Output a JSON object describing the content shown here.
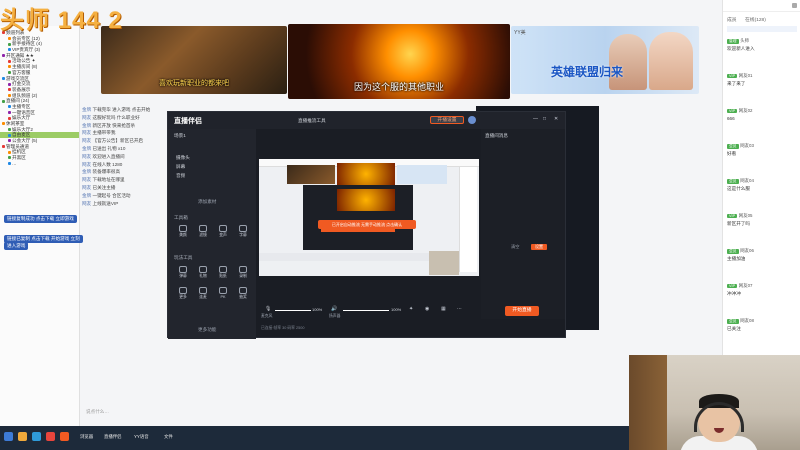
{
  "overlay": {
    "title": "头师 144 2"
  },
  "colors": {
    "accent_orange": "#f05a22",
    "select_green": "#9ccc65",
    "bubble_blue": "#2f5db5",
    "badge_green": "#4caf50"
  },
  "banners": [
    {
      "caption": "喜欢玩新职业的都来吧"
    },
    {
      "caption": "因为这个服的其他职业",
      "chip": ""
    },
    {
      "caption": "英雄联盟归来",
      "chip": "YY美"
    }
  ],
  "tree": [
    "频道列表",
    "会员专区 (12)",
    "新手接待区 (4)",
    "VIP贵宾厅 (3)",
    "开区通知 ★★",
    "活动公告 ✦",
    "主播房间 (8)",
    "官方客服",
    "游戏交流区",
    "打金交流",
    "装备展示",
    "组队频道 (2)",
    "直播间 (24)",
    "主播专区",
    "一键语音区",
    "娱乐大厅",
    "休闲茶室",
    "娱乐大厅2",
    "自由麦区",
    "公会大厅 (5)",
    "管理员通道",
    "挂机区",
    "开黑区",
    "…"
  ],
  "chat": {
    "rows": [
      {
        "user": "金牌",
        "text": "下载完毕 进入游戏 点击开始"
      },
      {
        "user": "网友",
        "text": "这服好玩吗 什么职业好"
      },
      {
        "user": "金牌",
        "text": "新区开放 快来抢首杀"
      },
      {
        "user": "网友",
        "text": "主播带带我"
      },
      {
        "user": "网友",
        "text": "【官方公告】新区已开启"
      },
      {
        "user": "金牌",
        "text": "已送出 礼物 x10"
      },
      {
        "user": "网友",
        "text": "欢迎进入直播间"
      },
      {
        "user": "网友",
        "text": "在线人数 1280"
      },
      {
        "user": "金牌",
        "text": "装备爆率很高"
      },
      {
        "user": "网友",
        "text": "下载地址在哪里"
      },
      {
        "user": "网友",
        "text": "已关注主播"
      },
      {
        "user": "金牌",
        "text": "一键起号 合区活动"
      },
      {
        "user": "网友",
        "text": "上线就送VIP"
      }
    ],
    "bubble1": "链接复制成功 点击下载 立即游戏",
    "bubble2": "链接已复制 点击下载 开始游戏 立刻",
    "bubble3": "进入游戏",
    "input_placeholder": "说点什么…"
  },
  "stream_window": {
    "app_name": "直播伴侣",
    "title": "直播推流工具",
    "scene_label": "场景1",
    "side_items": [
      "场景1",
      "摄像头",
      "屏幕",
      "音频"
    ],
    "add_label": "添加素材",
    "section_tools": "工具箱",
    "section_features": "玩法工具",
    "tools": [
      "美颜",
      "滤镜",
      "变声",
      "字幕",
      "弹幕",
      "礼物",
      "贴纸",
      "录制",
      "更多",
      "连麦",
      "PK",
      "抽奖"
    ],
    "more_link": "更多功能",
    "go_live": "开始直播",
    "volume1": "100%",
    "volume2": "100%",
    "mic_label": "麦克风",
    "speaker_label": "扬声器",
    "top_btn": "开播设置",
    "right_title": "直播间消息",
    "right_btn1": "清空",
    "right_btn2": "设置",
    "popup_text": "已开启自动推流 无需手动推流 点击确认",
    "popup_btn": "确认",
    "status": "已连接 帧率 30 码率 2500"
  },
  "right_panel": {
    "tab1": "成员",
    "tab2": "在线(128)",
    "users": [
      {
        "name": "头师",
        "badge": "管理",
        "msg": "欢迎新人进入"
      },
      {
        "name": "网友01",
        "badge": "VIP",
        "msg": "来了来了"
      },
      {
        "name": "网友02",
        "badge": "VIP",
        "msg": "666"
      },
      {
        "name": "网友03",
        "badge": "会员",
        "msg": "好看"
      },
      {
        "name": "网友04",
        "badge": "会员",
        "msg": "这是什么服"
      },
      {
        "name": "网友05",
        "badge": "VIP",
        "msg": "新区开了吗"
      },
      {
        "name": "网友06",
        "badge": "会员",
        "msg": "主播加油"
      },
      {
        "name": "网友07",
        "badge": "VIP",
        "msg": "冲冲冲"
      },
      {
        "name": "网友08",
        "badge": "会员",
        "msg": "已关注"
      }
    ]
  },
  "taskbar": {
    "items": [
      "浏览器",
      "直播伴侣",
      "YY语音",
      "文件"
    ]
  }
}
